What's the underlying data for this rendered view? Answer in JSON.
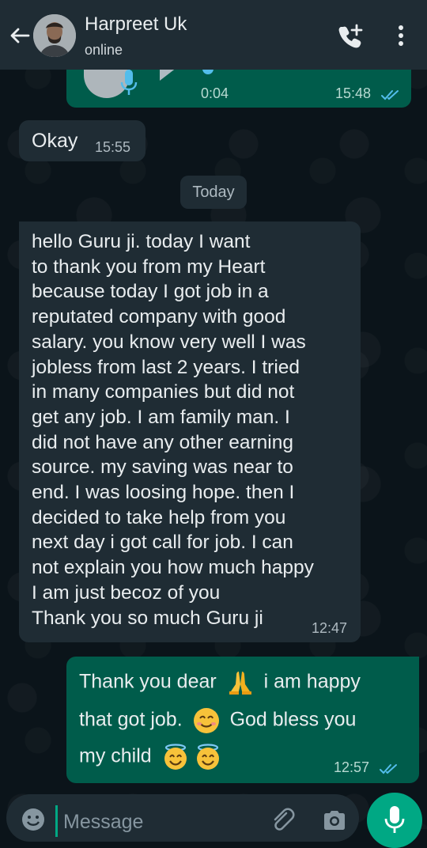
{
  "header": {
    "contact_name": "Harpreet Uk",
    "status": "online"
  },
  "messages": {
    "voice": {
      "duration": "0:04",
      "time": "15:48"
    },
    "okay": {
      "text": "Okay",
      "time": "15:55"
    },
    "date_divider": "Today",
    "long": {
      "text": "hello Guru ji. today I want\nto thank you from my Heart\nbecause today I got job in a\nreputated company with good\nsalary. you know very well I was\njobless from last 2 years. I tried\nin many companies but did not\nget any job. I am family man. I\ndid not have any other earning\nsource. my saving was near to\nend. I was loosing hope. then I\ndecided to take help from you\nnext day i got call for job. I can\nnot explain you how much happy\nI am just becoz of you\nThank you so much Guru ji",
      "time": "12:47"
    },
    "reply": {
      "line1a": "Thank you dear",
      "line1b": "i am happy",
      "line2a": "that got job.",
      "line2b": "God bless you",
      "line3": "my child",
      "time": "12:57"
    }
  },
  "composer": {
    "placeholder": "Message"
  },
  "colors": {
    "accent": "#00a884",
    "outgoing": "#005c4b",
    "incoming": "#1f2c34",
    "read_ticks": "#53bdeb"
  },
  "icons": [
    "back-arrow-icon",
    "add-call-icon",
    "more-options-icon",
    "play-icon",
    "mic-icon",
    "emoji-icon",
    "attach-icon",
    "camera-icon"
  ]
}
